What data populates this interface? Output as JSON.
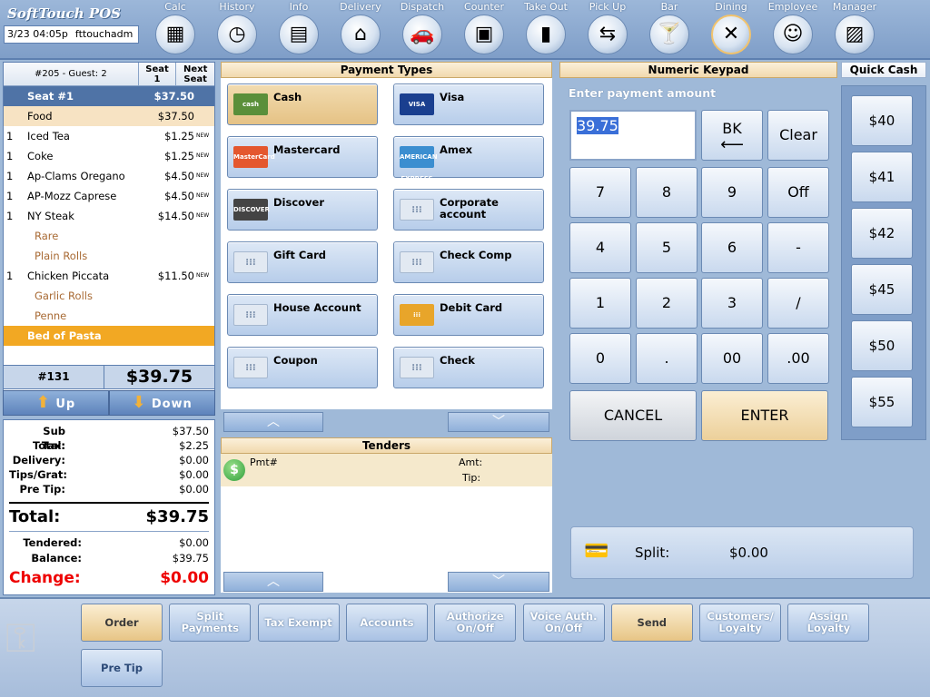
{
  "header": {
    "brand": "SoftTouch POS",
    "date_time": "3/23 04:05p",
    "user": "fttouchadm",
    "nav": [
      {
        "label": "Calc",
        "icon": "calculator-icon",
        "glyph": "▦"
      },
      {
        "label": "History",
        "icon": "clock-icon",
        "glyph": "◷"
      },
      {
        "label": "Info",
        "icon": "chalkboard-icon",
        "glyph": "▤"
      },
      {
        "label": "Delivery",
        "icon": "house-icon",
        "glyph": "⌂"
      },
      {
        "label": "Dispatch",
        "icon": "car-icon",
        "glyph": "🚗"
      },
      {
        "label": "Counter",
        "icon": "register-icon",
        "glyph": "▣"
      },
      {
        "label": "Take Out",
        "icon": "bag-icon",
        "glyph": "▮"
      },
      {
        "label": "Pick Up",
        "icon": "pickup-icon",
        "glyph": "⇆"
      },
      {
        "label": "Bar",
        "icon": "cocktail-icon",
        "glyph": "🍸"
      },
      {
        "label": "Dining",
        "icon": "fork-knife-icon",
        "glyph": "✕"
      },
      {
        "label": "Employee",
        "icon": "employee-icon",
        "glyph": "☺"
      },
      {
        "label": "Manager",
        "icon": "manager-icon",
        "glyph": "▨"
      }
    ]
  },
  "order": {
    "title": "#205 - Guest: 2",
    "seat_label": "Seat",
    "seat_num": "1",
    "next_seat": "Next Seat",
    "rows": [
      {
        "type": "seat",
        "qty": "",
        "name": "Seat #1",
        "price": "$37.50",
        "new": ""
      },
      {
        "type": "food",
        "qty": "",
        "name": "Food",
        "price": "$37.50",
        "new": ""
      },
      {
        "type": "item",
        "qty": "1",
        "name": "Iced Tea",
        "price": "$1.25",
        "new": "NEW"
      },
      {
        "type": "item",
        "qty": "1",
        "name": "Coke",
        "price": "$1.25",
        "new": "NEW"
      },
      {
        "type": "item",
        "qty": "1",
        "name": "Ap-Clams Oregano",
        "price": "$4.50",
        "new": "NEW"
      },
      {
        "type": "item",
        "qty": "1",
        "name": "AP-Mozz Caprese",
        "price": "$4.50",
        "new": "NEW"
      },
      {
        "type": "item",
        "qty": "1",
        "name": "NY Steak",
        "price": "$14.50",
        "new": "NEW"
      },
      {
        "type": "mod",
        "qty": "",
        "name": "Rare",
        "price": "",
        "new": ""
      },
      {
        "type": "mod",
        "qty": "",
        "name": "Plain Rolls",
        "price": "",
        "new": ""
      },
      {
        "type": "item",
        "qty": "1",
        "name": "Chicken Piccata",
        "price": "$11.50",
        "new": "NEW"
      },
      {
        "type": "mod",
        "qty": "",
        "name": "Garlic Rolls",
        "price": "",
        "new": ""
      },
      {
        "type": "mod",
        "qty": "",
        "name": "Penne",
        "price": "",
        "new": ""
      },
      {
        "type": "sel",
        "qty": "",
        "name": "Bed of Pasta",
        "price": "",
        "new": ""
      }
    ],
    "check_no": "#131",
    "check_total": "$39.75",
    "up": "Up",
    "down": "Down"
  },
  "totals": {
    "sub_total_label": "Sub Total:",
    "sub_total": "$37.50",
    "tax_label": "Tax:",
    "tax": "$2.25",
    "delivery_label": "Delivery:",
    "delivery": "$0.00",
    "tips_label": "Tips/Grat:",
    "tips": "$0.00",
    "pretip_label": "Pre Tip:",
    "pretip": "$0.00",
    "total_label": "Total:",
    "total": "$39.75",
    "tendered_label": "Tendered:",
    "tendered": "$0.00",
    "balance_label": "Balance:",
    "balance": "$39.75",
    "change_label": "Change:",
    "change": "$0.00"
  },
  "payment": {
    "title": "Payment Types",
    "types": [
      {
        "label": "Cash",
        "icon": "cash-icon",
        "badge": "cash",
        "color": "#5a8f3a"
      },
      {
        "label": "Visa",
        "icon": "visa-icon",
        "badge": "VISA",
        "color": "#1a3f8f"
      },
      {
        "label": "Mastercard",
        "icon": "mastercard-icon",
        "badge": "MasterCard",
        "color": "#e4572e"
      },
      {
        "label": "Amex",
        "icon": "amex-icon",
        "badge": "AMERICAN EXPRESS",
        "color": "#3b8ed0"
      },
      {
        "label": "Discover",
        "icon": "discover-icon",
        "badge": "DISCOVER",
        "color": "#444444"
      },
      {
        "label": "Corporate account",
        "icon": "card-icon",
        "badge": "",
        "color": ""
      },
      {
        "label": "Gift Card",
        "icon": "card-icon",
        "badge": "",
        "color": ""
      },
      {
        "label": "Check Comp",
        "icon": "card-icon",
        "badge": "",
        "color": ""
      },
      {
        "label": "House Account",
        "icon": "card-icon",
        "badge": "",
        "color": ""
      },
      {
        "label": "Debit Card",
        "icon": "debit-card-icon",
        "badge": "",
        "color": "#e8a52a"
      },
      {
        "label": "Coupon",
        "icon": "card-icon",
        "badge": "",
        "color": ""
      },
      {
        "label": "Check",
        "icon": "card-icon",
        "badge": "",
        "color": ""
      }
    ]
  },
  "tenders": {
    "title": "Tenders",
    "pmt_label": "Pmt#",
    "amt_label": "Amt:",
    "tip_label": "Tip:"
  },
  "keypad": {
    "title": "Numeric Keypad",
    "prompt": "Enter payment amount",
    "amount": "39.75",
    "bk": "BK",
    "clear": "Clear",
    "keys": [
      "7",
      "8",
      "9",
      "Off",
      "4",
      "5",
      "6",
      "-",
      "1",
      "2",
      "3",
      "/",
      "0",
      ".",
      "00",
      ".00"
    ],
    "cancel": "CANCEL",
    "enter": "ENTER"
  },
  "quick_cash": {
    "title": "Quick Cash",
    "amounts": [
      "$40",
      "$41",
      "$42",
      "$45",
      "$50",
      "$55"
    ]
  },
  "split": {
    "label": "Split:",
    "value": "$0.00"
  },
  "bottom": {
    "buttons": [
      {
        "label": "Order",
        "style": "tan"
      },
      {
        "label": "Split Payments",
        "style": ""
      },
      {
        "label": "Tax Exempt",
        "style": ""
      },
      {
        "label": "Accounts",
        "style": ""
      },
      {
        "label": "Authorize On/Off",
        "style": ""
      },
      {
        "label": "Voice Auth. On/Off",
        "style": ""
      },
      {
        "label": "Send",
        "style": "tan"
      },
      {
        "label": "Customers/ Loyalty",
        "style": ""
      },
      {
        "label": "Assign Loyalty",
        "style": ""
      }
    ],
    "pre_tip": "Pre Tip"
  }
}
